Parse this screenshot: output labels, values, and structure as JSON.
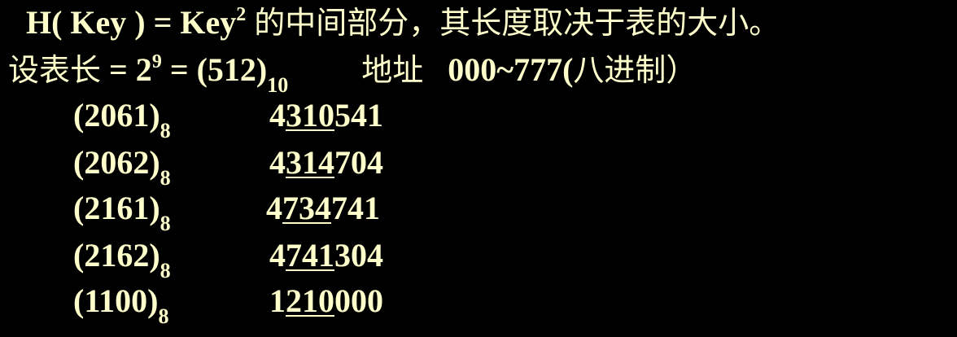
{
  "line1": {
    "formula_prefix": "H( Key ) = Key",
    "formula_sup": "2",
    "description": "的中间部分，其长度取决于表的大小。"
  },
  "line2": {
    "table_len_label": "设表长",
    "eq1": " = 2",
    "exp": "9",
    "eq2": "  = (512)",
    "base_sub": "10",
    "address_label": "地址",
    "address_range": "000~777(",
    "address_note": "八进制）"
  },
  "rows": [
    {
      "key": "(2061)",
      "key_base": "8",
      "square_pre": "4",
      "square_mid": "310",
      "square_post": "541"
    },
    {
      "key": "(2062)",
      "key_base": "8",
      "square_pre": "4",
      "square_mid": "314",
      "square_post": "704"
    },
    {
      "key": "(2161)",
      "key_base": "8",
      "square_pre": "4",
      "square_mid": "734",
      "square_post": "741"
    },
    {
      "key": "(2162)",
      "key_base": "8",
      "square_pre": "4",
      "square_mid": "741",
      "square_post": "304"
    },
    {
      "key": "(1100)",
      "key_base": "8",
      "square_pre": "1",
      "square_mid": "210",
      "square_post": "000"
    }
  ],
  "colors": {
    "background": "#000000",
    "text": "#FFFFCC"
  }
}
